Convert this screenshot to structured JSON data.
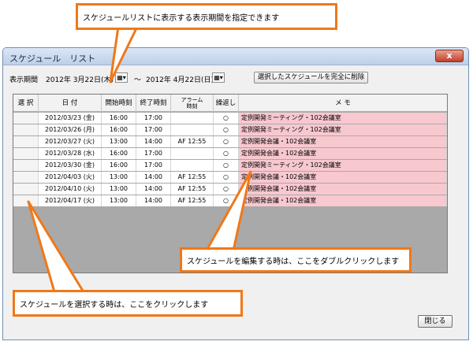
{
  "callouts": {
    "top": "スケジュールリストに表示する表示期間を指定できます",
    "edit": "スケジュールを編集する時は、ここをダブルクリックします",
    "select": "スケジュールを選択する時は、ここをクリックします"
  },
  "window": {
    "title": "スケジュール　リスト",
    "close_glyph": "x",
    "accent_color": "#f07818"
  },
  "filter": {
    "label": "表示期間",
    "start_date": "2012年 3月22日(木)",
    "tilde": "～",
    "end_date": "2012年 4月22日(日)",
    "calendar_glyph": "▦▾",
    "delete_button": "選択したスケジュールを完全に削除"
  },
  "table": {
    "headers": {
      "select": "選 択",
      "date": "日 付",
      "start": "開始時刻",
      "end": "終了時刻",
      "alarm_top": "アラーム",
      "alarm_bottom": "時刻",
      "repeat": "繰返し",
      "memo": "メ モ"
    },
    "rows": [
      {
        "date": "2012/03/23 (金)",
        "start": "16:00",
        "end": "17:00",
        "alarm": "",
        "repeat": "○",
        "memo": "定例開発ミーティング・102会議室"
      },
      {
        "date": "2012/03/26 (月)",
        "start": "16:00",
        "end": "17:00",
        "alarm": "",
        "repeat": "○",
        "memo": "定例開発ミーティング・102会議室"
      },
      {
        "date": "2012/03/27 (火)",
        "start": "13:00",
        "end": "14:00",
        "alarm": "AF  12:55",
        "repeat": "○",
        "memo": "定例開発会議・102会議室"
      },
      {
        "date": "2012/03/28 (水)",
        "start": "16:00",
        "end": "17:00",
        "alarm": "",
        "repeat": "○",
        "memo": "定例開発会議・102会議室"
      },
      {
        "date": "2012/03/30 (金)",
        "start": "16:00",
        "end": "17:00",
        "alarm": "",
        "repeat": "○",
        "memo": "定例開発ミーティング・102会議室"
      },
      {
        "date": "2012/04/03 (火)",
        "start": "13:00",
        "end": "14:00",
        "alarm": "AF  12:55",
        "repeat": "○",
        "memo": "定例開発会議・102会議室"
      },
      {
        "date": "2012/04/10 (火)",
        "start": "13:00",
        "end": "14:00",
        "alarm": "AF  12:55",
        "repeat": "○",
        "memo": "定例開発会議・102会議室"
      },
      {
        "date": "2012/04/17 (火)",
        "start": "13:00",
        "end": "14:00",
        "alarm": "AF  12:55",
        "repeat": "○",
        "memo": "定例開発会議・102会議室"
      }
    ]
  },
  "footer": {
    "close_button": "閉じる"
  }
}
